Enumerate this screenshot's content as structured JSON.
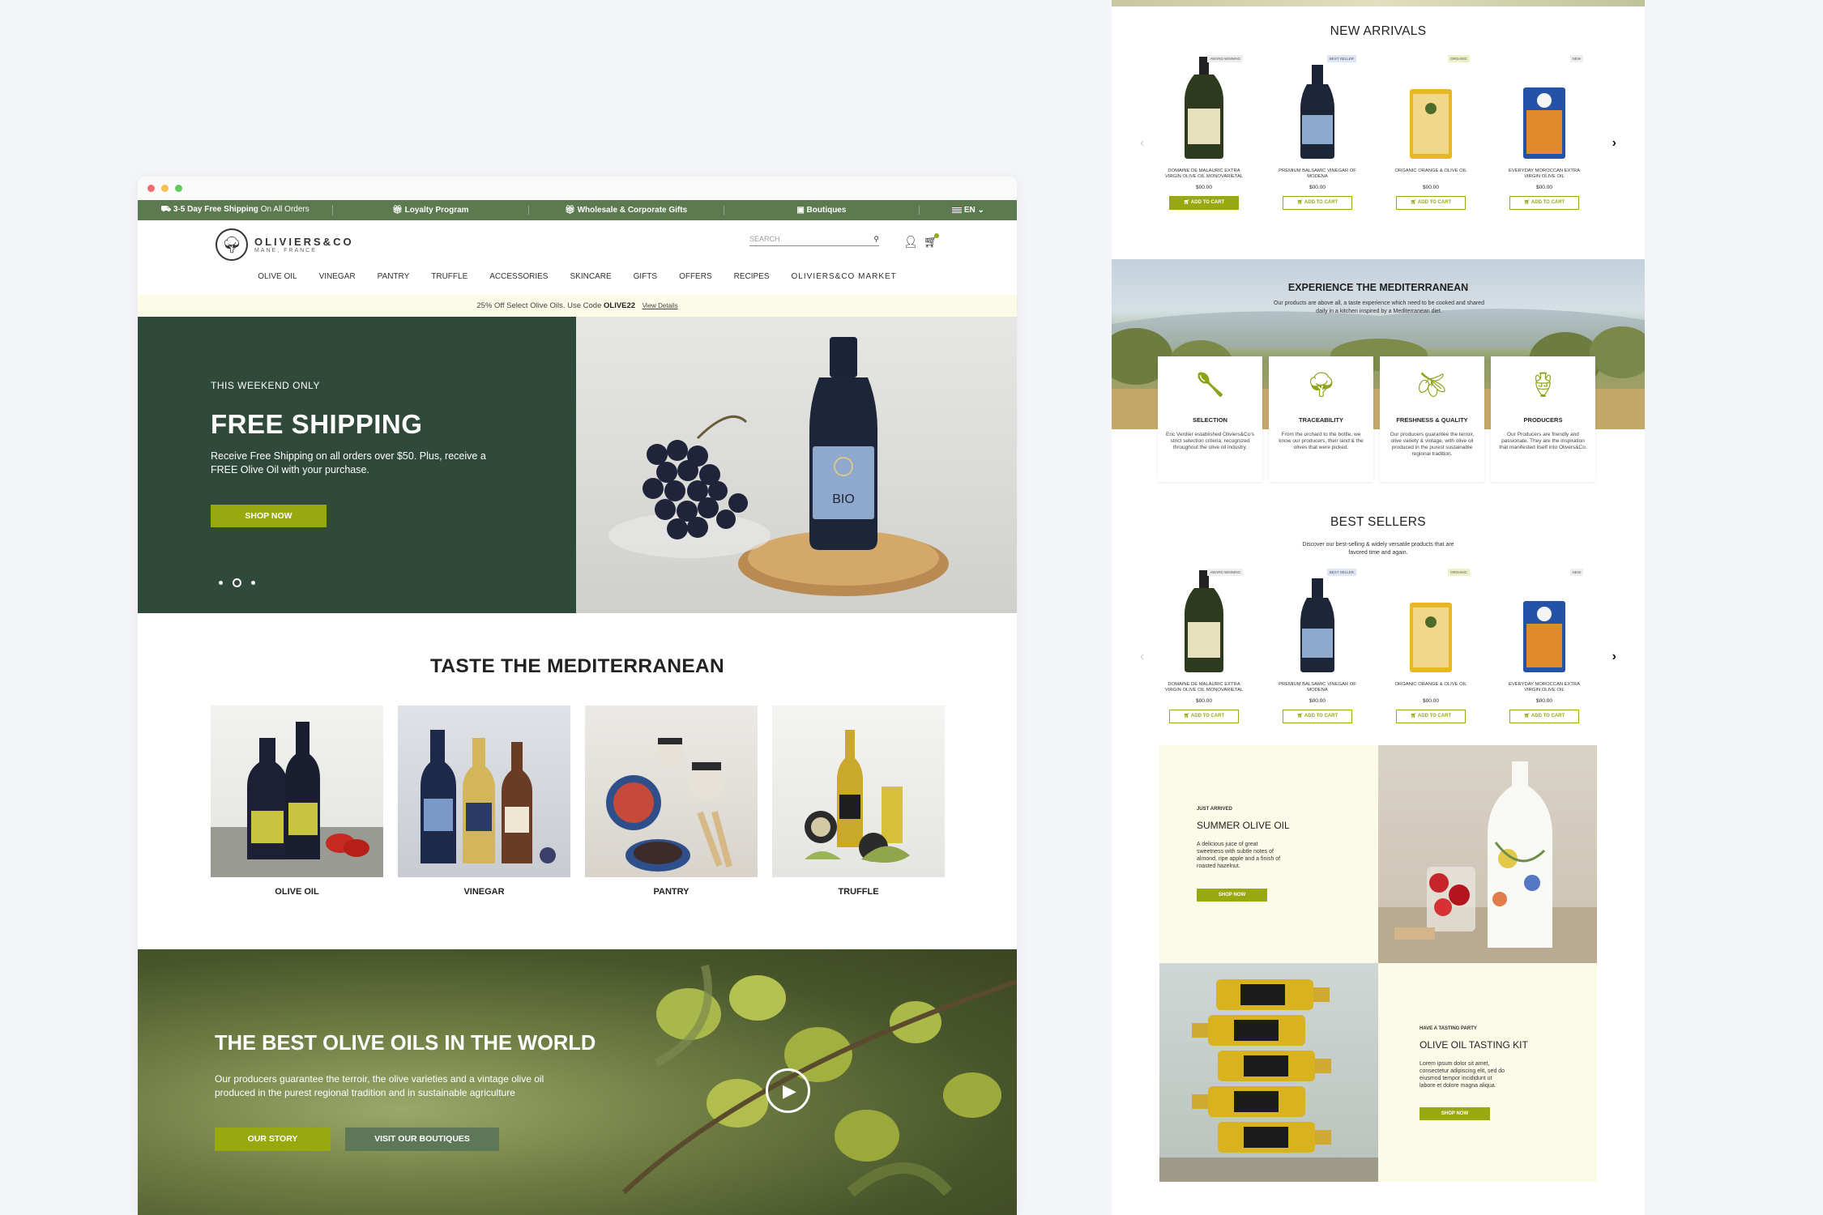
{
  "colors": {
    "topbar_green": "#5c7a4f",
    "hero_green": "#2f4a3b",
    "olive_accent": "#97a90e",
    "promo_bg": "#fbfbe8"
  },
  "topbar": {
    "shipping_bold": "3-5 Day Free Shipping",
    "shipping_rest": "On All Orders",
    "loyalty": "Loyalty Program",
    "wholesale": "Wholesale & Corporate Gifts",
    "boutiques": "Boutiques",
    "language": "EN"
  },
  "logo": {
    "name": "OLIVIERS&CO",
    "sub": "MANE, FRANCE"
  },
  "search": {
    "placeholder": "SEARCH"
  },
  "nav": [
    "OLIVE OIL",
    "VINEGAR",
    "PANTRY",
    "TRUFFLE",
    "ACCESSORIES",
    "SKINCARE",
    "GIFTS",
    "OFFERS",
    "RECIPES",
    "OLIVIERS&CO MARKET"
  ],
  "promo": {
    "text": "25% Off Select Olive Oils. Use Code",
    "code": "OLIVE22",
    "link": "View Details"
  },
  "hero": {
    "kicker": "THIS WEEKEND ONLY",
    "title": "FREE SHIPPING",
    "text": "Receive Free Shipping on all orders over $50. Plus, receive a FREE Olive Oil with your purchase.",
    "button": "SHOP NOW",
    "bottle_label": "BIO"
  },
  "taste": {
    "title": "TASTE THE MEDITERRANEAN",
    "categories": [
      "OLIVE OIL",
      "VINEGAR",
      "PANTRY",
      "TRUFFLE"
    ]
  },
  "best_oils": {
    "title": "THE BEST OLIVE OILS IN THE WORLD",
    "text": "Our producers guarantee the terroir, the olive varieties and a vintage olive oil produced in the purest regional tradition and in sustainable agriculture",
    "button1": "OUR STORY",
    "button2": "VISIT OUR BOUTIQUES"
  },
  "new_arrivals": {
    "title": "NEW ARRIVALS",
    "products": [
      {
        "badge": "AWARD WINNING",
        "name": "DOMAINE DE MALAURIC EXTRA VIRGIN OLIVE OIL MONOVARIETAL",
        "price": "$00.00",
        "cta": "ADD TO CART"
      },
      {
        "badge": "BEST SELLER",
        "name": "PREMIUM BALSAMIC VINEGAR OF MODENA",
        "price": "$00.00",
        "cta": "ADD TO CART"
      },
      {
        "badge": "ORGANIC",
        "name": "ORGANIC ORANGE & OLIVE OIL",
        "price": "$00.00",
        "cta": "ADD TO CART"
      },
      {
        "badge": "NEW",
        "name": "EVERYDAY MOROCCAN EXTRA VIRGIN OLIVE OIL",
        "price": "$00.00",
        "cta": "ADD TO CART"
      }
    ]
  },
  "experience": {
    "title": "EXPERIENCE THE MEDITERRANEAN",
    "subtitle": "Our products are above all, a taste experience which need to be cooked and shared daily in a kitchen inspired by a Mediterranean diet.",
    "features": [
      {
        "icon": "spoon-icon",
        "title": "SELECTION",
        "text": "Eric Verdier established Oliviers&Co's strict selection criteria; recognized throughout the olive oil industry."
      },
      {
        "icon": "tree-icon",
        "title": "TRACEABILITY",
        "text": "From the orchard to the bottle, we know our producers, their land & the olives that were picked."
      },
      {
        "icon": "olives-icon",
        "title": "FRESHNESS & QUALITY",
        "text": "Our producers guarantee the terroir, olive variety & vintage, with olive oil produced in the purest sustainable regional tradition."
      },
      {
        "icon": "hand-jar-icon",
        "title": "PRODUCERS",
        "text": "Our Producers are friendly and passionate. They are the inspiration that manifested itself into Olivers&Co."
      }
    ]
  },
  "best_sellers": {
    "title": "BEST SELLERS",
    "subtitle": "Discover our best-selling & widely versatile products that are favored time and again.",
    "products": [
      {
        "badge": "AWARD WINNING",
        "name": "DOMAINE DE MALAURIC EXTRA VIRGIN OLIVE OIL MONOVARIETAL",
        "price": "$00.00",
        "cta": "ADD TO CART"
      },
      {
        "badge": "BEST SELLER",
        "name": "PREMIUM BALSAMIC VINEGAR OF MODENA",
        "price": "$00.00",
        "cta": "ADD TO CART"
      },
      {
        "badge": "ORGANIC",
        "name": "ORGANIC ORANGE & OLIVE OIL",
        "price": "$00.00",
        "cta": "ADD TO CART"
      },
      {
        "badge": "NEW",
        "name": "EVERYDAY MOROCCAN EXTRA VIRGIN OLIVE OIL",
        "price": "$00.00",
        "cta": "ADD TO CART"
      }
    ]
  },
  "summer": {
    "kicker": "JUST ARRIVED",
    "title": "SUMMER OLIVE OIL",
    "text": "A delicious juice of great sweetness with subtle notes of almond, ripe apple and a finish of roasted hazelnut.",
    "button": "SHOP NOW"
  },
  "tasting": {
    "kicker": "HAVE A TASTING PARTY",
    "title": "OLIVE OIL TASTING KIT",
    "text": "Lorem ipsum dolor sit amet, consectetur adipiscing elit, sed do eiusmod tempor incididunt ut labore et dolore magna aliqua.",
    "button": "SHOP NOW"
  }
}
